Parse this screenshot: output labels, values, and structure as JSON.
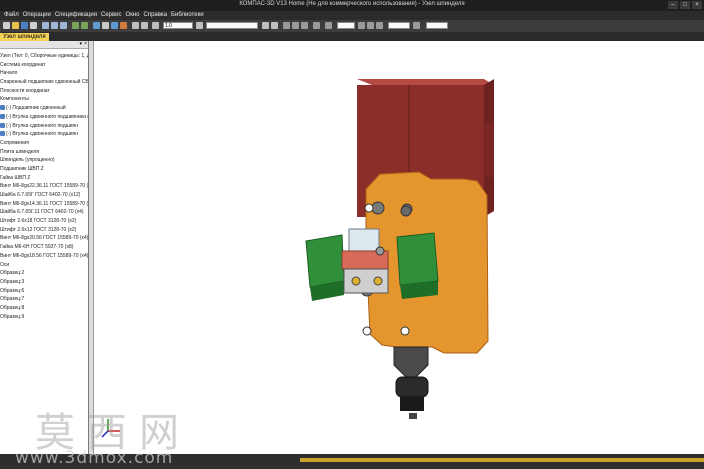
{
  "window": {
    "title": "КОМПАС-3D V13 Home (Не для коммерческого использования) - Узел шпинделя"
  },
  "menu": [
    "Файл",
    "Операции",
    "Спецификация",
    "Сервис",
    "Окно",
    "Справка",
    "Библиотеки"
  ],
  "toolbar": {
    "scale_value": "1.0"
  },
  "document_tab": "Узел шпинделя",
  "tree": [
    "Узел (Тел: 0, Сборочные единицы: 1, Детал",
    "Система координат",
    "Начало",
    "Спаренный подшипник сдвоенный СБ",
    "Плоскости координат",
    "Компоненты",
    "(-) Подшипник сдвоенный",
    "(-) Втулка сдвоенного подшипника (x2)",
    "(-) Втулка сдвоенного подшипн",
    "(-) Втулка сдвоенного подшипн",
    "Сопряжения",
    "Плита шпинделя",
    "Шпиндель (упрощенно)",
    "Подшипник ШВП Z",
    "Гайка ШВП Z",
    "Винт М6-8gx22.36.11 ГОСТ 15589-70 (x4)",
    "Шайба 6.7.65Г ГОСТ 6402-70 (x12)",
    "Винт М6-8gx14.36.11 ГОСТ 15589-70 (x8)",
    "Шайба 6.7.65Г.11 ГОСТ 6402-70 (x4)",
    "Штифт 2.6x18 ГОСТ 3128-70 (x2)",
    "Штифт 2.6x12 ГОСТ 3128-70 (x2)",
    "Винт М6-8gx20.56 ГОСТ 15589-70 (x4)",
    "Гайка М6-6Н ГОСТ 5927-70 (x8)",
    "Винт М6-8gx18.56 ГОСТ 15589-70 (x4)",
    "Оси",
    "Образец:2",
    "Образец:3",
    "Образец:6",
    "Образец:7",
    "Образец:8",
    "Образец:9"
  ],
  "watermark": {
    "chars": "莫西网",
    "url": "www.3dmox.com"
  },
  "colors": {
    "motor": "#8b2e2a",
    "plate": "#e5952e",
    "block": "#2f8f3a",
    "accent": "#f5d25a"
  }
}
